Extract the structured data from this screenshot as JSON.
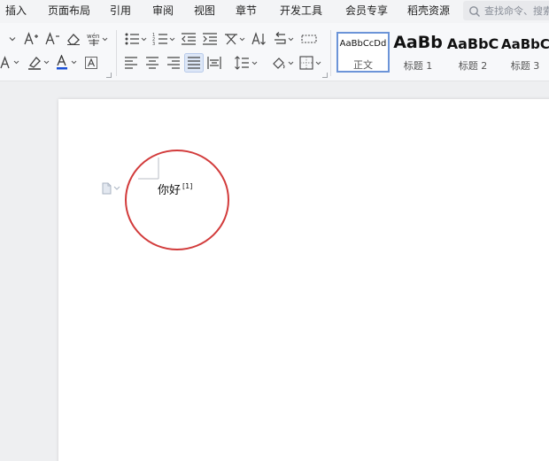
{
  "menu": {
    "items": [
      "插入",
      "页面布局",
      "引用",
      "审阅",
      "视图",
      "章节",
      "开发工具",
      "会员专享",
      "稻壳资源"
    ],
    "search_placeholder": "查找命令、搜索"
  },
  "ribbon": {
    "styles": [
      {
        "sample": "AaBbCcDd",
        "name": "正文"
      },
      {
        "sample": "AaBb",
        "name": "标题 1"
      },
      {
        "sample": "AaBbC",
        "name": "标题 2"
      },
      {
        "sample": "AaBbC",
        "name": "标题 3"
      }
    ]
  },
  "document": {
    "text": "你好",
    "footnote_ref": "[1]"
  },
  "colors": {
    "annotation_circle": "#d23b3b",
    "font_color_underline": "#1a4fd6",
    "selected_style_border": "#6c94d8"
  }
}
